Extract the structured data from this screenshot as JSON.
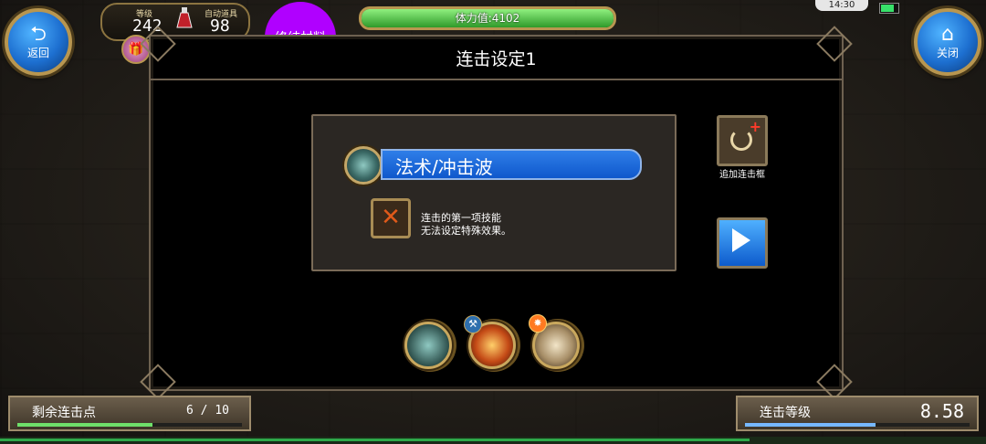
{
  "top_bar": {
    "back_label": "返回",
    "close_label": "关闭",
    "level_label": "等级",
    "level_value": "242",
    "auto_item_label": "自动道具",
    "auto_item_value": "98",
    "stamina_text": "体力值:4102",
    "stamina_fill": 1.0,
    "clock": "14:30",
    "battery_level": 0.8
  },
  "overlay_bubble": {
    "text": "终结材料",
    "color": "#b000ff"
  },
  "panel": {
    "title": "连击设定1",
    "skill_name": "法术/冲击波",
    "no_effect_text": "连击的第一项技能\n无法设定特殊效果。",
    "add_frame_label": "追加连击框"
  },
  "combo_skills": [
    {
      "name": "skill-magic-icon"
    },
    {
      "name": "skill-fire-icon"
    },
    {
      "name": "skill-fist-icon"
    }
  ],
  "bottom": {
    "remaining_label": "剩余连击点",
    "remaining_value": "6 / 10",
    "remaining_fill": 0.6,
    "combo_level_label": "连击等级",
    "combo_level_value": "8.58",
    "combo_level_fill": 0.58
  },
  "colors": {
    "accent_blue": "#1d6fd0",
    "gold_border": "#b89650",
    "stamina_green": "#2f9a2a"
  }
}
